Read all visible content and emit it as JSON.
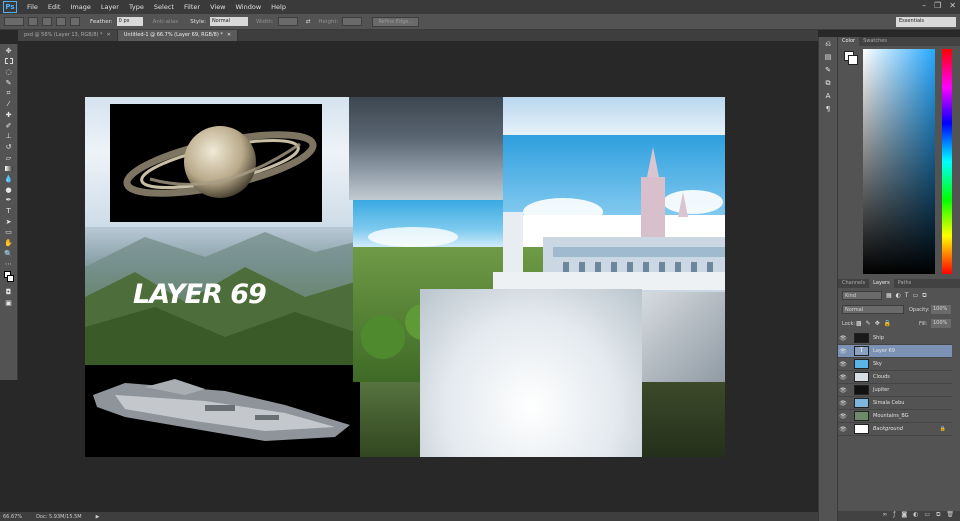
{
  "app": {
    "logo": "Ps"
  },
  "menu": [
    "File",
    "Edit",
    "Image",
    "Layer",
    "Type",
    "Select",
    "Filter",
    "View",
    "Window",
    "Help"
  ],
  "window_controls": {
    "minimize": "–",
    "restore": "❐",
    "close": "✕"
  },
  "options": {
    "feather_label": "Feather:",
    "feather_value": "0 px",
    "antialias_label": "Anti-alias",
    "style_label": "Style:",
    "style_value": "Normal",
    "width_label": "Width:",
    "height_label": "Height:",
    "refine_edge": "Refine Edge...",
    "workspace": "Essentials"
  },
  "tabs": [
    {
      "label": "psd @ 56% (Layer 13, RGB/8) *",
      "close": "✕",
      "active": false
    },
    {
      "label": "Untitled-1 @ 66.7% (Layer 69, RGB/8) *",
      "close": "✕",
      "active": true
    }
  ],
  "canvas": {
    "layer_text": "LAYER 69"
  },
  "status": {
    "zoom": "66.67%",
    "doc": "Doc: 5.93M/15.5M",
    "arrow": "▶"
  },
  "color_panel": {
    "tabs": [
      "Color",
      "Swatches"
    ]
  },
  "layers_panel": {
    "tabs": [
      "Channels",
      "Layers",
      "Paths"
    ],
    "kind": "Kind",
    "blend_mode": "Normal",
    "opacity_label": "Opacity:",
    "opacity": "100%",
    "lock_label": "Lock:",
    "fill_label": "Fill:",
    "fill": "100%",
    "layers": [
      {
        "name": "Ship",
        "selected": false
      },
      {
        "name": "Layer 69",
        "selected": true
      },
      {
        "name": "Sky",
        "selected": false
      },
      {
        "name": "Clouds",
        "selected": false
      },
      {
        "name": "Jupiter",
        "selected": false
      },
      {
        "name": "Simala Cebu",
        "selected": false
      },
      {
        "name": "Mountains_BG",
        "selected": false
      },
      {
        "name": "Background",
        "selected": false
      }
    ]
  },
  "colors": {
    "accent": "#4fb0ff",
    "selected_layer": "#7c92b4",
    "panel_bg": "#535353"
  }
}
